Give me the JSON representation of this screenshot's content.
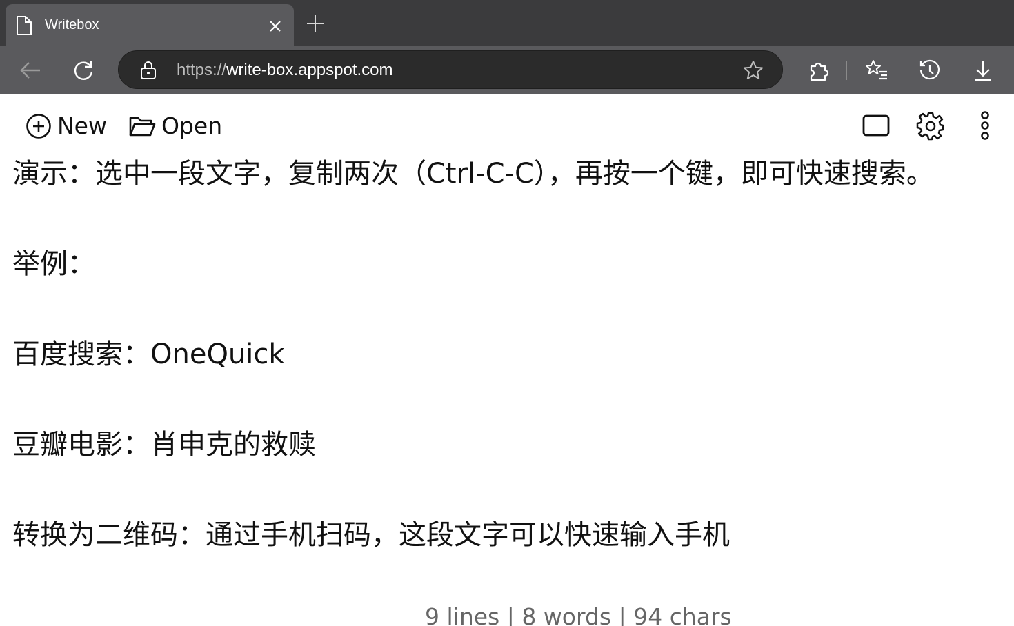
{
  "browser": {
    "tab_title": "Writebox",
    "url_scheme": "https://",
    "url_host": "write-box.appspot.com"
  },
  "app_toolbar": {
    "new_label": "New",
    "open_label": "Open"
  },
  "editor": {
    "lines": [
      "演示：选中一段文字，复制两次（Ctrl-C-C），再按一个键，即可快速搜索。",
      "",
      "举例：",
      "",
      "百度搜索：OneQuick",
      "",
      "豆瓣电影：肖申克的救赎",
      "",
      "转换为二维码：通过手机扫码，这段文字可以快速输入手机"
    ]
  },
  "status": {
    "text": "9 lines | 8 words | 94 chars"
  }
}
